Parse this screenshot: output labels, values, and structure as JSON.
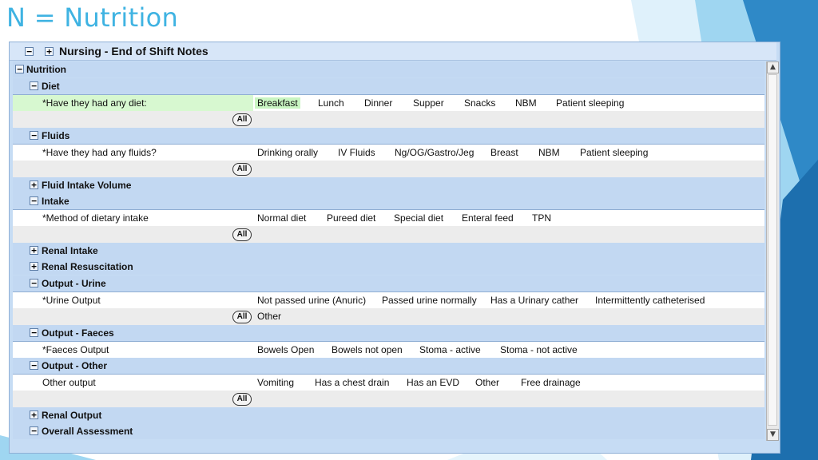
{
  "slide": {
    "title": "N = Nutrition"
  },
  "panel": {
    "title": "Nursing - End of Shift Notes"
  },
  "sections": {
    "nutrition": "Nutrition",
    "diet": "Diet",
    "fluids": "Fluids",
    "fluid_intake_volume": "Fluid Intake Volume",
    "intake": "Intake",
    "renal_intake": "Renal Intake",
    "renal_resuscitation": "Renal Resuscitation",
    "output_urine": "Output - Urine",
    "output_faeces": "Output - Faeces",
    "output_other": "Output - Other",
    "renal_output": "Renal Output",
    "overall_assessment": "Overall Assessment"
  },
  "questions": {
    "diet": {
      "label": "*Have they had any diet:",
      "options": [
        "Breakfast",
        "Lunch",
        "Dinner",
        "Supper",
        "Snacks",
        "NBM",
        "Patient sleeping"
      ],
      "selected": "Breakfast"
    },
    "fluids": {
      "label": "*Have they had any fluids?",
      "options": [
        "Drinking orally",
        "IV Fluids",
        "Ng/OG/Gastro/Jeg",
        "Breast",
        "NBM",
        "Patient sleeping"
      ]
    },
    "intake": {
      "label": "*Method of dietary intake",
      "options": [
        "Normal diet",
        "Pureed diet",
        "Special diet",
        "Enteral feed",
        "TPN"
      ]
    },
    "urine": {
      "label": "*Urine Output",
      "options": [
        "Not passed urine (Anuric)",
        "Passed urine normally",
        "Has a Urinary cather",
        "Intermittently catheterised"
      ],
      "options2": [
        "Other"
      ]
    },
    "faeces": {
      "label": "*Faeces Output",
      "options": [
        "Bowels Open",
        "Bowels not open",
        "Stoma - active",
        "Stoma - not active"
      ]
    },
    "other": {
      "label": "Other output",
      "options": [
        "Vomiting",
        "Has a chest drain",
        "Has an EVD",
        "Other",
        "Free drainage"
      ]
    }
  },
  "all_label": "All",
  "icons": {
    "collapse": "−",
    "expand": "+",
    "scroll_up": "▲",
    "scroll_down": "▼"
  },
  "colors": {
    "title": "#3fb3e2",
    "section_bg": "#c2d8f2",
    "selected_bg": "#c9f5c2"
  }
}
